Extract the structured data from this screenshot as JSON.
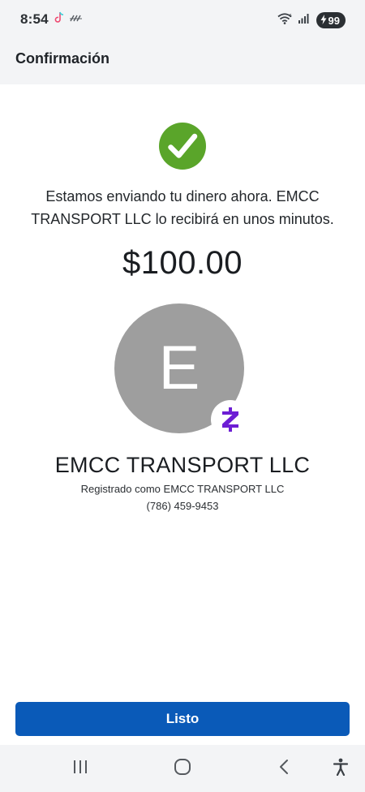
{
  "status_bar": {
    "time": "8:54",
    "battery_level": "99",
    "icons": [
      "tiktok-icon",
      "dnd-slashes-icon",
      "wifi-icon",
      "signal-icon",
      "battery-charging-icon"
    ]
  },
  "header": {
    "title": "Confirmación"
  },
  "confirmation": {
    "icon": "check-circle-icon",
    "success_color": "#5aa52a",
    "message": "Estamos enviando tu dinero ahora. EMCC TRANSPORT LLC lo recibirá en unos minutos.",
    "amount": "$100.00"
  },
  "recipient": {
    "avatar_initial": "E",
    "avatar_color": "#9e9e9e",
    "badge_icon": "zelle-icon",
    "badge_color": "#6d1ed4",
    "name": "EMCC TRANSPORT LLC",
    "registered_as": "Registrado como EMCC TRANSPORT LLC",
    "phone": "(786) 459-9453"
  },
  "actions": {
    "done_label": "Listo",
    "done_color": "#0a5ab8"
  },
  "nav_bar": {
    "icons": [
      "recent-apps-icon",
      "home-icon",
      "back-icon",
      "accessibility-icon"
    ]
  }
}
